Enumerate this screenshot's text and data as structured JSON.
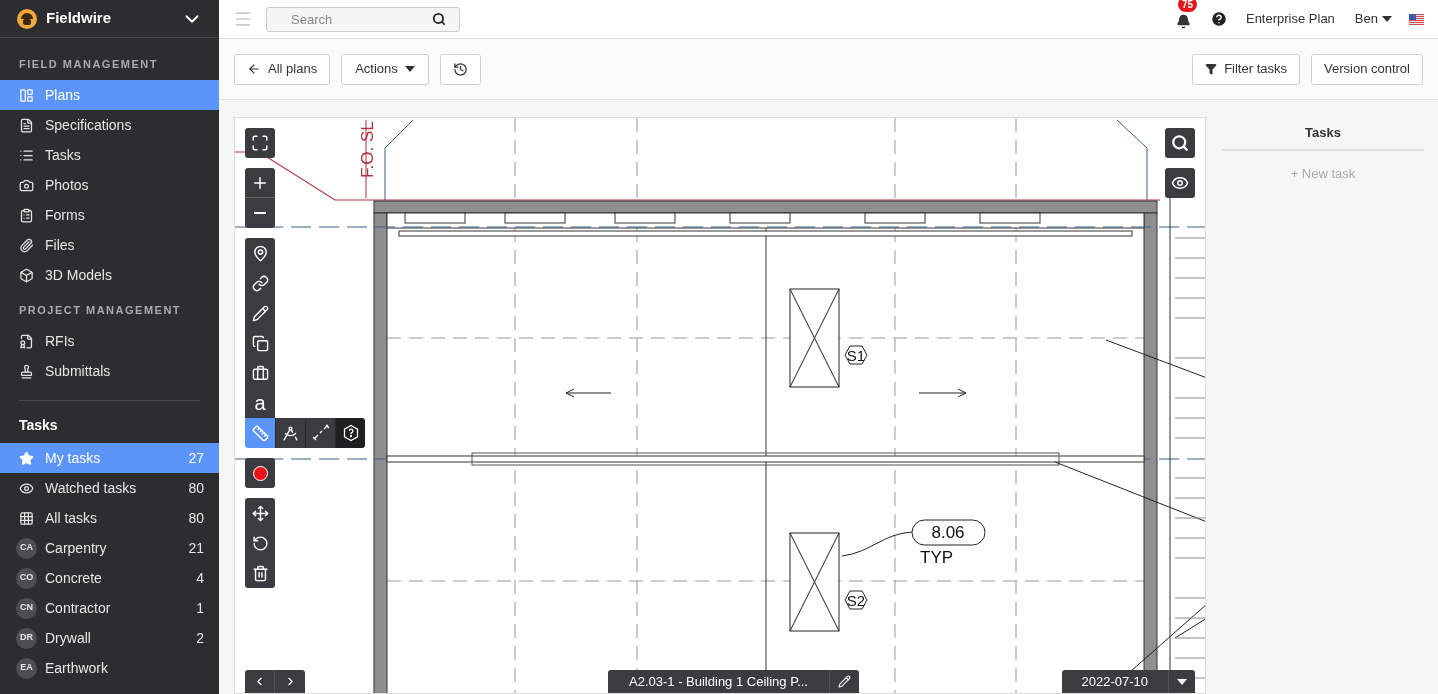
{
  "app": {
    "name": "Fieldwire"
  },
  "sidebar": {
    "sections": [
      {
        "heading": "FIELD MANAGEMENT",
        "items": [
          {
            "label": "Plans",
            "selected": true
          },
          {
            "label": "Specifications",
            "selected": false
          },
          {
            "label": "Tasks",
            "selected": false
          },
          {
            "label": "Photos",
            "selected": false
          },
          {
            "label": "Forms",
            "selected": false
          },
          {
            "label": "Files",
            "selected": false
          },
          {
            "label": "3D Models",
            "selected": false
          }
        ]
      },
      {
        "heading": "PROJECT MANAGEMENT",
        "items": [
          {
            "label": "RFIs",
            "selected": false
          },
          {
            "label": "Submittals",
            "selected": false
          }
        ]
      }
    ],
    "tasks": {
      "heading": "Tasks",
      "items": [
        {
          "kind": "icon",
          "label": "My tasks",
          "count": "27",
          "selected": true
        },
        {
          "kind": "icon",
          "label": "Watched tasks",
          "count": "80",
          "selected": false
        },
        {
          "kind": "icon",
          "label": "All tasks",
          "count": "80",
          "selected": false
        },
        {
          "kind": "initials",
          "initials": "CA",
          "label": "Carpentry",
          "count": "21",
          "selected": false
        },
        {
          "kind": "initials",
          "initials": "CO",
          "label": "Concrete",
          "count": "4",
          "selected": false
        },
        {
          "kind": "initials",
          "initials": "CN",
          "label": "Contractor",
          "count": "1",
          "selected": false
        },
        {
          "kind": "initials",
          "initials": "DR",
          "label": "Drywall",
          "count": "2",
          "selected": false
        },
        {
          "kind": "initials",
          "initials": "EA",
          "label": "Earthwork",
          "selected": false
        }
      ]
    }
  },
  "topbar": {
    "search": {
      "placeholder": "Search"
    },
    "notifications": "75",
    "plan": "Enterprise Plan",
    "user": "Ben"
  },
  "toolbar": {
    "back": "All plans",
    "actions": "Actions",
    "filter": "Filter tasks",
    "version": "Version control"
  },
  "viewer": {
    "measure_tools": [
      {
        "selected": true,
        "hovered": false
      },
      {
        "selected": false,
        "hovered": false
      },
      {
        "selected": false,
        "hovered": false
      },
      {
        "selected": false,
        "hovered": true
      }
    ],
    "text_tool": "a",
    "sheet": "A2.03-1 - Building 1 Ceiling P...",
    "date": "2022-07-10",
    "plan_labels": {
      "slab": "F.O. SL",
      "tag_1": "S1",
      "tag_2": "S2",
      "callout": "8.06",
      "typ": "TYP"
    }
  },
  "tasks_panel": {
    "title": "Tasks",
    "new_task": "+ New task"
  }
}
